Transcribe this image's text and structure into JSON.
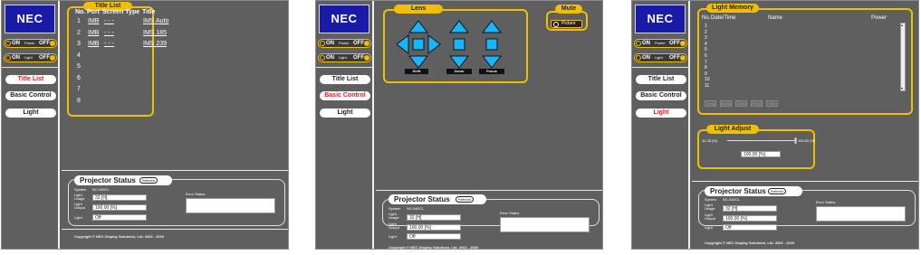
{
  "brand": "NEC",
  "power": {
    "on": "ON",
    "label": "Power",
    "off": "OFF"
  },
  "light_toggle": {
    "on": "ON",
    "label": "Light",
    "off": "OFF"
  },
  "nav": {
    "title_list": "Title List",
    "basic_control": "Basic Control",
    "light": "Light"
  },
  "title_list": {
    "tab": "Title List",
    "headers": {
      "no": "No.",
      "port": "Port",
      "screen_type": "Screen Type",
      "title": "Title"
    },
    "rows": [
      {
        "no": "1",
        "port": "IMB",
        "screen_type": "- - -",
        "title": "IMS Auto"
      },
      {
        "no": "2",
        "port": "IMB",
        "screen_type": "- - -",
        "title": "IMS 185"
      },
      {
        "no": "3",
        "port": "IMB",
        "screen_type": "- - -",
        "title": "IMS 239"
      },
      {
        "no": "4"
      },
      {
        "no": "5"
      },
      {
        "no": "6"
      },
      {
        "no": "7"
      },
      {
        "no": "8"
      }
    ]
  },
  "lens": {
    "tab": "Lens",
    "shift": "Shift",
    "zoom": "Zoom",
    "focus": "Focus"
  },
  "mute": {
    "tab": "Mute",
    "picture": "Picture"
  },
  "light_memory": {
    "tab": "Light Memory",
    "headers": {
      "no": "No.",
      "datetime": "Date/Time",
      "name": "Name",
      "power": "Power"
    },
    "numbers": [
      "1",
      "2",
      "3",
      "4",
      "5",
      "6",
      "7",
      "8",
      "9",
      "10",
      "11"
    ],
    "buttons": [
      "Entry",
      "Delete",
      "Clear",
      "Photo",
      "Test"
    ]
  },
  "light_adjust": {
    "tab": "Light Adjust",
    "min": "32.28 [%]",
    "max": "100.00 [%]",
    "value": "100.00 [%]",
    "level_percent": 100
  },
  "status": {
    "title": "Projector Status",
    "refresh": "Refresh",
    "system_label": "System",
    "system_value": "NC-940CL",
    "light_usage_label": "Light Usage",
    "light_usage": "32 [H]",
    "light_output_label": "Light Output",
    "light_output": "100.00 [%]",
    "light_label": "Light",
    "light": "Off",
    "error_label": "Error Status"
  },
  "copyright": "Copyright © NEC Display Solutions, Ltd. 2002 - 2020",
  "colors": {
    "accent": "#f0c000",
    "background": "#5f5f5f",
    "logo": "#1a1aa8",
    "active": "#e02020"
  }
}
